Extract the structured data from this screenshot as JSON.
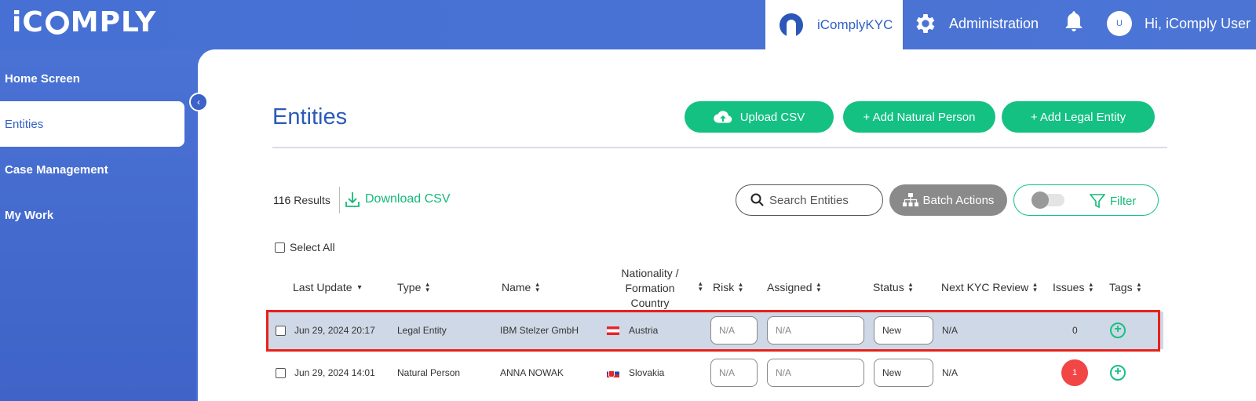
{
  "app": {
    "logo_prefix": "i",
    "logo_suffix": "MPLY",
    "logo_c": "C",
    "product_tab": "iComplyKYC",
    "administration": "Administration",
    "greeting": "Hi, iComply User",
    "avatar_initial": "U"
  },
  "sidebar": {
    "items": [
      {
        "label": "Home Screen"
      },
      {
        "label": "Entities"
      },
      {
        "label": "Case Management"
      },
      {
        "label": "My Work"
      }
    ],
    "collapse_glyph": "‹"
  },
  "page": {
    "title": "Entities",
    "upload_csv": "Upload CSV",
    "add_natural_person": "+ Add Natural Person",
    "add_legal_entity": "+ Add Legal Entity",
    "results_count": "116",
    "results_label": "Results",
    "download_csv": "Download CSV",
    "search_placeholder": "Search Entities",
    "batch_actions": "Batch Actions",
    "filter": "Filter",
    "select_all": "Select All"
  },
  "table": {
    "headers": {
      "last_update": "Last Update",
      "type": "Type",
      "name": "Name",
      "nationality_1": "Nationality /",
      "nationality_2": "Formation",
      "nationality_3": "Country",
      "risk": "Risk",
      "assigned": "Assigned",
      "status": "Status",
      "next_kyc": "Next KYC Review",
      "issues": "Issues",
      "tags": "Tags"
    },
    "rows": [
      {
        "last_update": "Jun 29, 2024 20:17",
        "type": "Legal Entity",
        "name": "IBM Stelzer GmbH",
        "country": "Austria",
        "risk": "N/A",
        "assigned": "N/A",
        "status": "New",
        "next_kyc": "N/A",
        "issues": "0"
      },
      {
        "last_update": "Jun 29, 2024 14:01",
        "type": "Natural Person",
        "name": "ANNA NOWAK",
        "country": "Slovakia",
        "risk": "N/A",
        "assigned": "N/A",
        "status": "New",
        "next_kyc": "N/A",
        "issues": "1"
      }
    ]
  },
  "colors": {
    "brand_blue": "#4a72d4",
    "accent_green": "#14c183",
    "issue_red": "#f24545",
    "highlight_red": "#e8201a"
  }
}
